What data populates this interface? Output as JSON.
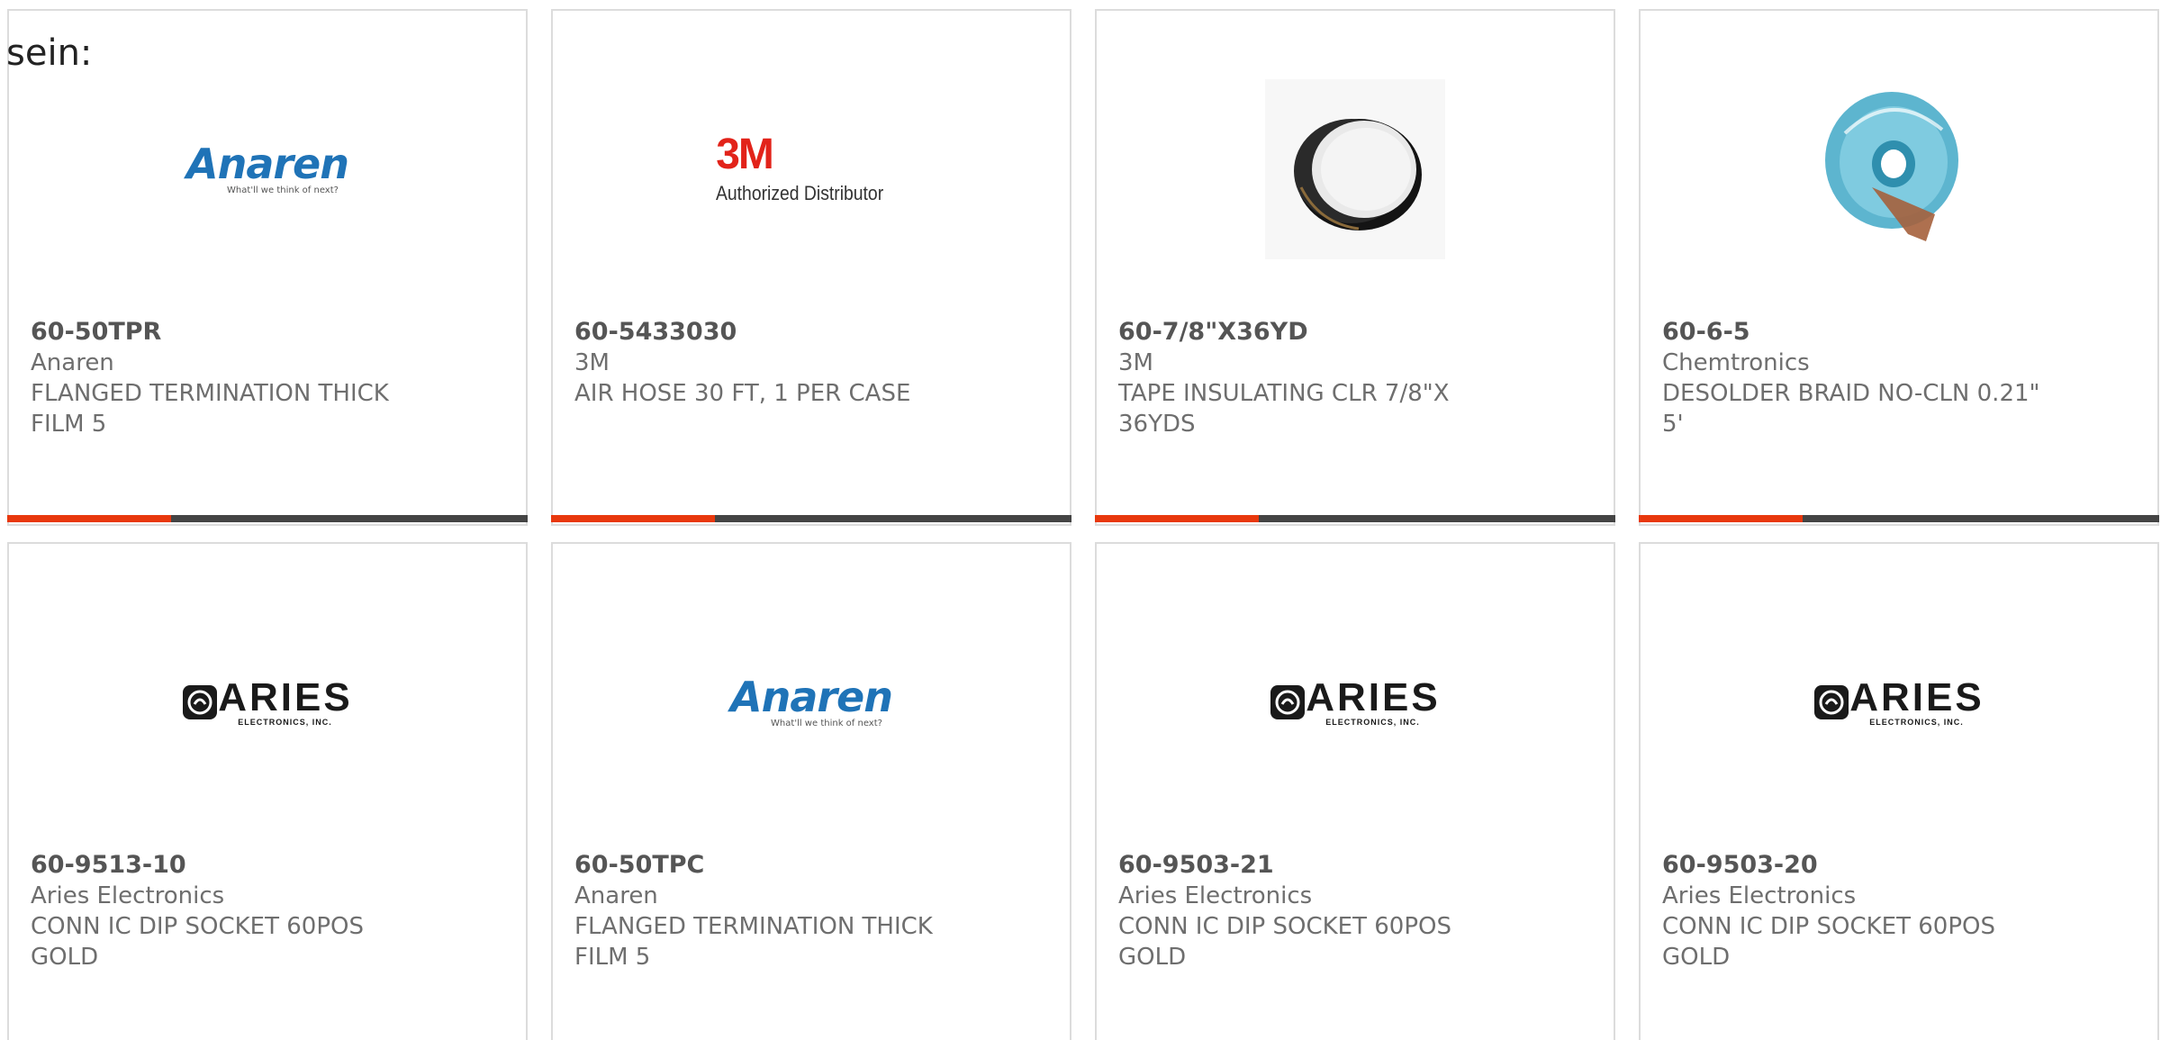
{
  "intro_text": "sein:",
  "colors": {
    "accent": "#e8380d",
    "bar": "#444444",
    "card_border": "#dcdcdc",
    "text": "#6e6e6e"
  },
  "products": [
    {
      "part_number": "60-50TPR",
      "manufacturer": "Anaren",
      "description": "FLANGED TERMINATION THICK FILM 5",
      "image": {
        "kind": "anaren-logo",
        "word": "Anaren",
        "tagline": "What'll we think of next?"
      }
    },
    {
      "part_number": "60-5433030",
      "manufacturer": "3M",
      "description": "AIR HOSE 30 FT, 1 PER CASE",
      "image": {
        "kind": "3m-logo",
        "mark": "3M",
        "subtitle": "Authorized Distributor"
      }
    },
    {
      "part_number": "60-7/8\"X36YD",
      "manufacturer": "3M",
      "description": "TAPE INSULATING CLR 7/8\"X 36YDS",
      "image": {
        "kind": "tape-photo"
      }
    },
    {
      "part_number": "60-6-5",
      "manufacturer": "Chemtronics",
      "description": "DESOLDER BRAID NO-CLN 0.21\" 5'",
      "image": {
        "kind": "braid-photo"
      }
    },
    {
      "part_number": "60-9513-10",
      "manufacturer": "Aries Electronics",
      "description": "CONN IC DIP SOCKET 60POS GOLD",
      "image": {
        "kind": "aries-logo",
        "word": "ARIES",
        "subtitle": "ELECTRONICS, INC."
      }
    },
    {
      "part_number": "60-50TPC",
      "manufacturer": "Anaren",
      "description": "FLANGED TERMINATION THICK FILM 5",
      "image": {
        "kind": "anaren-logo",
        "word": "Anaren",
        "tagline": "What'll we think of next?"
      }
    },
    {
      "part_number": "60-9503-21",
      "manufacturer": "Aries Electronics",
      "description": "CONN IC DIP SOCKET 60POS GOLD",
      "image": {
        "kind": "aries-logo",
        "word": "ARIES",
        "subtitle": "ELECTRONICS, INC."
      }
    },
    {
      "part_number": "60-9503-20",
      "manufacturer": "Aries Electronics",
      "description": "CONN IC DIP SOCKET 60POS GOLD",
      "image": {
        "kind": "aries-logo",
        "word": "ARIES",
        "subtitle": "ELECTRONICS, INC."
      }
    }
  ]
}
